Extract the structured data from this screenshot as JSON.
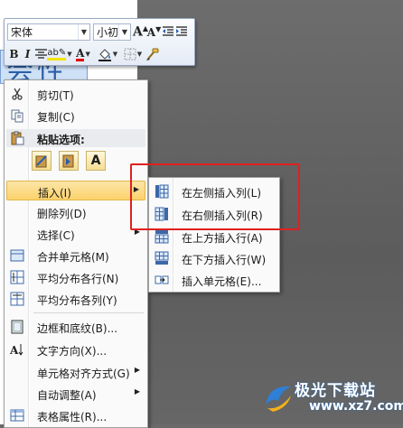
{
  "document": {
    "cell_text": "会性"
  },
  "mini_toolbar": {
    "font_name": "宋体",
    "font_size": "小初",
    "grow_font": "A",
    "shrink_font": "A",
    "bold": "B",
    "italic": "I",
    "highlight": "ab",
    "font_color": "A"
  },
  "context_menu": {
    "items": [
      {
        "label": "剪切(T)",
        "icon": "scissors-icon"
      },
      {
        "label": "复制(C)",
        "icon": "copy-icon"
      },
      {
        "label": "插入(I)",
        "icon": "",
        "submenu": true
      },
      {
        "label": "删除列(D)",
        "icon": ""
      },
      {
        "label": "选择(C)",
        "icon": "",
        "submenu": true
      },
      {
        "label": "合并单元格(M)",
        "icon": "merge-cells-icon"
      },
      {
        "label": "平均分布各行(N)",
        "icon": "distribute-rows-icon"
      },
      {
        "label": "平均分布各列(Y)",
        "icon": "distribute-columns-icon"
      },
      {
        "label": "边框和底纹(B)...",
        "icon": "borders-icon"
      },
      {
        "label": "文字方向(X)...",
        "icon": "text-direction-icon"
      },
      {
        "label": "单元格对齐方式(G)",
        "icon": "",
        "submenu": true
      },
      {
        "label": "自动调整(A)",
        "icon": "",
        "submenu": true
      },
      {
        "label": "表格属性(R)...",
        "icon": "table-properties-icon"
      }
    ],
    "paste_header": "粘贴选项:",
    "paste_text_only": "A"
  },
  "submenu": {
    "items": [
      {
        "label": "在左侧插入列(L)",
        "icon": "insert-column-left-icon"
      },
      {
        "label": "在右侧插入列(R)",
        "icon": "insert-column-right-icon"
      },
      {
        "label": "在上方插入行(A)",
        "icon": "insert-row-above-icon"
      },
      {
        "label": "在下方插入行(W)",
        "icon": "insert-row-below-icon"
      },
      {
        "label": "插入单元格(E)...",
        "icon": "insert-cells-icon"
      }
    ]
  },
  "watermark": {
    "text": "极光下载站",
    "url": "www.xz7.com"
  },
  "colors": {
    "highlight_box": "#e02020",
    "menu_hover": "#fbd26b",
    "font_color_red": "#e00000"
  }
}
